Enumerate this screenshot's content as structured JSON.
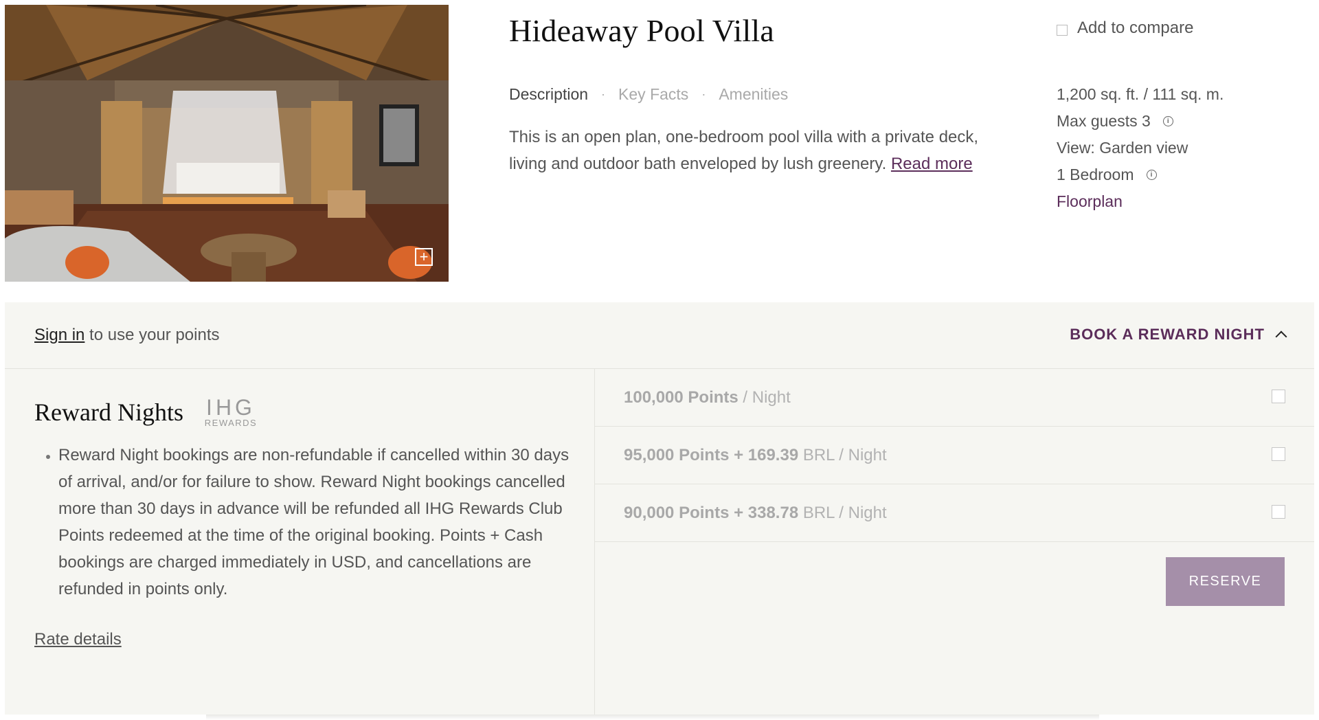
{
  "room": {
    "title": "Hideaway Pool Villa",
    "compare_label": "Add to compare",
    "tabs": [
      "Description",
      "Key Facts",
      "Amenities"
    ],
    "description": "This is an open plan, one-bedroom pool villa with a private deck, living and outdoor bath enveloped by lush greenery.",
    "read_more": "Read more",
    "facts": {
      "size": "1,200 sq. ft. / 111 sq. m.",
      "max_guests": "Max guests 3",
      "view": "View: Garden view",
      "bedroom": "1 Bedroom",
      "floorplan": "Floorplan"
    },
    "expand_icon": "+"
  },
  "rewards": {
    "signin_link": "Sign in",
    "signin_rest": " to use your points",
    "book_toggle": "BOOK A REWARD NIGHT",
    "title": "Reward Nights",
    "logo_big": "IHG",
    "logo_small": "REWARDS",
    "policy": "Reward Night bookings are non-refundable if cancelled within 30 days of arrival, and/or for failure to show. Reward Night bookings cancelled more than 30 days in advance will be refunded all IHG Rewards Club Points redeemed at the time of the original booking. Points + Cash bookings are charged immediately in USD, and cancellations are refunded in points only.",
    "rate_details": "Rate details",
    "options": [
      {
        "bold": "100,000 Points",
        "rest": " / Night"
      },
      {
        "bold": "95,000 Points + 169.39",
        "rest": " BRL / Night"
      },
      {
        "bold": "90,000 Points + 338.78",
        "rest": " BRL / Night"
      }
    ],
    "reserve": "RESERVE"
  },
  "colors": {
    "accent_purple": "#5b2d5a",
    "reserve_bg": "#a58fa9",
    "panel_bg": "#f6f6f2"
  },
  "icons": [
    "expand-icon",
    "info-icon",
    "chevron-up-icon",
    "checkbox-icon"
  ]
}
